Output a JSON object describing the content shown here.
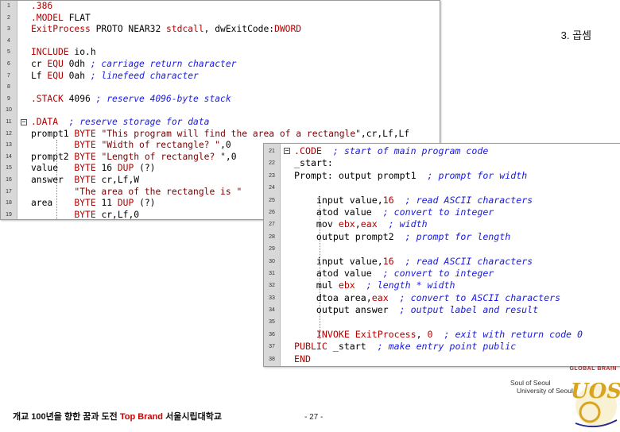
{
  "slide": {
    "title": "3. 곱셈",
    "footer_slogan_1": "개교 100년을 향한 꿈과 도전",
    "footer_slogan_brand": "Top Brand",
    "footer_slogan_2": "서울시립대학교",
    "page_number": "- 27 -"
  },
  "logo": {
    "top_text": "GLOBAL BRAIN",
    "line1": "Soul of Seoul",
    "line2": "University of Seoul",
    "emblem": "UOS"
  },
  "colors": {
    "keyword": "#b00000",
    "comment": "#1a1ae0",
    "brand_red": "#d00000",
    "gutter": "#d8d8d8"
  },
  "editor1": {
    "lines": [
      {
        "num": "1",
        "fold": false,
        "tokens": [
          {
            "t": ".386",
            "c": "kw"
          }
        ]
      },
      {
        "num": "2",
        "fold": false,
        "tokens": [
          {
            "t": ".MODEL ",
            "c": "kw"
          },
          {
            "t": "FLAT",
            "c": "pl"
          }
        ]
      },
      {
        "num": "3",
        "fold": false,
        "tokens": [
          {
            "t": "ExitProcess",
            "c": "kw"
          },
          {
            "t": " PROTO NEAR32 ",
            "c": "pl"
          },
          {
            "t": "stdcall",
            "c": "kw"
          },
          {
            "t": ", dwExitCode:",
            "c": "pl"
          },
          {
            "t": "DWORD",
            "c": "kw"
          }
        ]
      },
      {
        "num": "4",
        "fold": false,
        "tokens": []
      },
      {
        "num": "5",
        "fold": false,
        "tokens": [
          {
            "t": "INCLUDE",
            "c": "kw"
          },
          {
            "t": " io.h",
            "c": "pl"
          }
        ]
      },
      {
        "num": "6",
        "fold": false,
        "tokens": [
          {
            "t": "cr ",
            "c": "pl"
          },
          {
            "t": "EQU",
            "c": "kw"
          },
          {
            "t": " 0dh ",
            "c": "pl"
          },
          {
            "t": "; carriage return character",
            "c": "cm"
          }
        ]
      },
      {
        "num": "7",
        "fold": false,
        "tokens": [
          {
            "t": "Lf ",
            "c": "pl"
          },
          {
            "t": "EQU",
            "c": "kw"
          },
          {
            "t": " 0ah ",
            "c": "pl"
          },
          {
            "t": "; linefeed character",
            "c": "cm"
          }
        ]
      },
      {
        "num": "8",
        "fold": false,
        "tokens": []
      },
      {
        "num": "9",
        "fold": false,
        "tokens": [
          {
            "t": ".STACK",
            "c": "kw"
          },
          {
            "t": " 4096 ",
            "c": "pl"
          },
          {
            "t": "; reserve 4096-byte stack",
            "c": "cm"
          }
        ]
      },
      {
        "num": "10",
        "fold": false,
        "tokens": []
      },
      {
        "num": "11",
        "fold": true,
        "tokens": [
          {
            "t": ".DATA",
            "c": "kw"
          },
          {
            "t": "  ",
            "c": "pl"
          },
          {
            "t": "; reserve storage for data",
            "c": "cm"
          }
        ]
      },
      {
        "num": "12",
        "fold": false,
        "tokens": [
          {
            "t": "prompt1 ",
            "c": "pl"
          },
          {
            "t": "BYTE",
            "c": "ty"
          },
          {
            "t": " ",
            "c": "pl"
          },
          {
            "t": "\"This program will find the area of a rectangle\"",
            "c": "str"
          },
          {
            "t": ",cr,Lf,Lf",
            "c": "pl"
          }
        ]
      },
      {
        "num": "13",
        "fold": false,
        "tokens": [
          {
            "t": "        ",
            "c": "pl"
          },
          {
            "t": "BYTE",
            "c": "ty"
          },
          {
            "t": " ",
            "c": "pl"
          },
          {
            "t": "\"Width of rectangle? \"",
            "c": "str"
          },
          {
            "t": ",0",
            "c": "pl"
          }
        ]
      },
      {
        "num": "14",
        "fold": false,
        "tokens": [
          {
            "t": "prompt2 ",
            "c": "pl"
          },
          {
            "t": "BYTE",
            "c": "ty"
          },
          {
            "t": " ",
            "c": "pl"
          },
          {
            "t": "\"Length of rectangle? \"",
            "c": "str"
          },
          {
            "t": ",0",
            "c": "pl"
          }
        ]
      },
      {
        "num": "15",
        "fold": false,
        "tokens": [
          {
            "t": "value   ",
            "c": "pl"
          },
          {
            "t": "BYTE",
            "c": "ty"
          },
          {
            "t": " 16 ",
            "c": "pl"
          },
          {
            "t": "DUP",
            "c": "kw"
          },
          {
            "t": " (?)",
            "c": "pl"
          }
        ]
      },
      {
        "num": "16",
        "fold": false,
        "tokens": [
          {
            "t": "answer  ",
            "c": "pl"
          },
          {
            "t": "BYTE",
            "c": "ty"
          },
          {
            "t": " cr,Lf,W",
            "c": "pl"
          }
        ]
      },
      {
        "num": "17",
        "fold": false,
        "tokens": [
          {
            "t": "        ",
            "c": "pl"
          },
          {
            "t": "\"The area of the rectangle is \"",
            "c": "str"
          }
        ]
      },
      {
        "num": "18",
        "fold": false,
        "tokens": [
          {
            "t": "area    ",
            "c": "pl"
          },
          {
            "t": "BYTE",
            "c": "ty"
          },
          {
            "t": " 11 ",
            "c": "pl"
          },
          {
            "t": "DUP",
            "c": "kw"
          },
          {
            "t": " (?)",
            "c": "pl"
          }
        ]
      },
      {
        "num": "19",
        "fold": false,
        "tokens": [
          {
            "t": "        ",
            "c": "pl"
          },
          {
            "t": "BYTE",
            "c": "ty"
          },
          {
            "t": " cr,Lf,0",
            "c": "pl"
          }
        ]
      }
    ]
  },
  "editor2": {
    "lines": [
      {
        "num": "21",
        "fold": true,
        "tokens": [
          {
            "t": ".CODE",
            "c": "kw"
          },
          {
            "t": "  ",
            "c": "pl"
          },
          {
            "t": "; start of main program code",
            "c": "cm"
          }
        ]
      },
      {
        "num": "22",
        "fold": false,
        "tokens": [
          {
            "t": "_start:",
            "c": "pl"
          }
        ]
      },
      {
        "num": "23",
        "fold": false,
        "tokens": [
          {
            "t": "Prompt: output prompt1  ",
            "c": "pl"
          },
          {
            "t": "; prompt for width",
            "c": "cm"
          }
        ]
      },
      {
        "num": "24",
        "fold": false,
        "tokens": []
      },
      {
        "num": "25",
        "fold": false,
        "tokens": [
          {
            "t": "    input value,",
            "c": "pl"
          },
          {
            "t": "16",
            "c": "num"
          },
          {
            "t": "  ",
            "c": "pl"
          },
          {
            "t": "; read ASCII characters",
            "c": "cm"
          }
        ]
      },
      {
        "num": "26",
        "fold": false,
        "tokens": [
          {
            "t": "    atod value  ",
            "c": "pl"
          },
          {
            "t": "; convert to integer",
            "c": "cm"
          }
        ]
      },
      {
        "num": "27",
        "fold": false,
        "tokens": [
          {
            "t": "    mov ",
            "c": "pl"
          },
          {
            "t": "ebx",
            "c": "kw"
          },
          {
            "t": ",",
            "c": "pl"
          },
          {
            "t": "eax",
            "c": "kw"
          },
          {
            "t": "  ",
            "c": "pl"
          },
          {
            "t": "; width",
            "c": "cm"
          }
        ]
      },
      {
        "num": "28",
        "fold": false,
        "tokens": [
          {
            "t": "    output prompt2  ",
            "c": "pl"
          },
          {
            "t": "; prompt for length",
            "c": "cm"
          }
        ]
      },
      {
        "num": "29",
        "fold": false,
        "tokens": []
      },
      {
        "num": "30",
        "fold": false,
        "tokens": [
          {
            "t": "    input value,",
            "c": "pl"
          },
          {
            "t": "16",
            "c": "num"
          },
          {
            "t": "  ",
            "c": "pl"
          },
          {
            "t": "; read ASCII characters",
            "c": "cm"
          }
        ]
      },
      {
        "num": "31",
        "fold": false,
        "tokens": [
          {
            "t": "    atod value  ",
            "c": "pl"
          },
          {
            "t": "; convert to integer",
            "c": "cm"
          }
        ]
      },
      {
        "num": "32",
        "fold": false,
        "tokens": [
          {
            "t": "    mul ",
            "c": "pl"
          },
          {
            "t": "ebx",
            "c": "kw"
          },
          {
            "t": "  ",
            "c": "pl"
          },
          {
            "t": "; length * width",
            "c": "cm"
          }
        ]
      },
      {
        "num": "33",
        "fold": false,
        "tokens": [
          {
            "t": "    dtoa area,",
            "c": "pl"
          },
          {
            "t": "eax",
            "c": "kw"
          },
          {
            "t": "  ",
            "c": "pl"
          },
          {
            "t": "; convert to ASCII characters",
            "c": "cm"
          }
        ]
      },
      {
        "num": "34",
        "fold": false,
        "tokens": [
          {
            "t": "    output answer  ",
            "c": "pl"
          },
          {
            "t": "; output label and result",
            "c": "cm"
          }
        ]
      },
      {
        "num": "35",
        "fold": false,
        "tokens": []
      },
      {
        "num": "36",
        "fold": false,
        "tokens": [
          {
            "t": "    ",
            "c": "pl"
          },
          {
            "t": "INVOKE",
            "c": "kw"
          },
          {
            "t": " ",
            "c": "pl"
          },
          {
            "t": "ExitProcess",
            "c": "kw"
          },
          {
            "t": ", ",
            "c": "pl"
          },
          {
            "t": "0",
            "c": "num"
          },
          {
            "t": "  ",
            "c": "pl"
          },
          {
            "t": "; exit with return code 0",
            "c": "cm"
          }
        ]
      },
      {
        "num": "37",
        "fold": false,
        "tokens": [
          {
            "t": "PUBLIC",
            "c": "kw"
          },
          {
            "t": " _start  ",
            "c": "pl"
          },
          {
            "t": "; make entry point public",
            "c": "cm"
          }
        ]
      },
      {
        "num": "38",
        "fold": false,
        "tokens": [
          {
            "t": "END",
            "c": "kw"
          }
        ]
      }
    ]
  }
}
